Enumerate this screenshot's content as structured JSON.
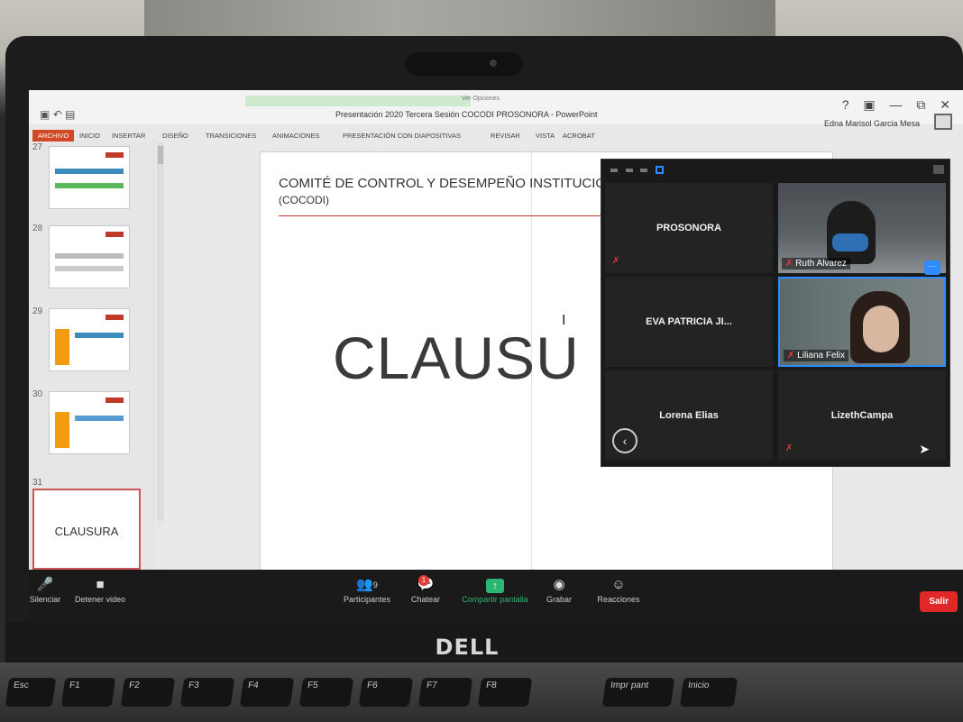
{
  "powerpoint": {
    "tool_tab_label": "Ver Opciones",
    "window_title": "Presentación 2020 Tercera Sesión COCODI PROSONORA - PowerPoint",
    "user_name": "Edna Marisol Garcia Mesa",
    "window_controls": "? ▣ — ⧉ ✕",
    "ribbon_tabs": {
      "file": "ARCHIVO",
      "inicio": "INICIO",
      "insertar": "INSERTAR",
      "diseno": "DISEÑO",
      "transiciones": "TRANSICIONES",
      "animaciones": "ANIMACIONES",
      "presentacion": "PRESENTACIÓN CON DIAPOSITIVAS",
      "revisar": "REVISAR",
      "vista": "VISTA",
      "acrobat": "ACROBAT"
    },
    "thumbnails": {
      "n27": "27",
      "n28": "28",
      "n29": "29",
      "n30": "30",
      "n31": "31",
      "current_title": "CLAUSURA"
    },
    "slide": {
      "heading": "COMITÉ DE CONTROL Y DESEMPEÑO INSTITUCION",
      "subheading": "(COCODI)",
      "big_text": "CLAUSU"
    }
  },
  "zoom": {
    "gallery": {
      "tiles": {
        "prosonora": "PROSONORA",
        "ruth": "Ruth Alvarez",
        "eva": "EVA PATRICIA JI...",
        "liliana": "Liliana Felix",
        "lorena": "Lorena Elias",
        "lizeth": "LizethCampa"
      },
      "more_label": "···"
    },
    "controls": {
      "mute": "Silenciar",
      "stop_video": "Detener video",
      "participants": "Participantes",
      "participants_count": "9",
      "chat": "Chatear",
      "chat_badge": "1",
      "share": "Compartir pantalla",
      "record": "Grabar",
      "reactions": "Reacciones",
      "leave": "Salir"
    }
  },
  "hardware": {
    "brand": "DELL",
    "keys": {
      "esc": "Esc",
      "f1": "F1",
      "f2": "F2",
      "f3": "F3",
      "f4": "F4",
      "f5": "F5",
      "f6": "F6",
      "f7": "F7",
      "f8": "F8",
      "prtsc": "Impr pant",
      "ins": "Inicio"
    }
  },
  "colors": {
    "ppt_accent": "#d24726",
    "zoom_blue": "#2d8cff",
    "zoom_green": "#2bb673",
    "leave_red": "#e02828"
  }
}
